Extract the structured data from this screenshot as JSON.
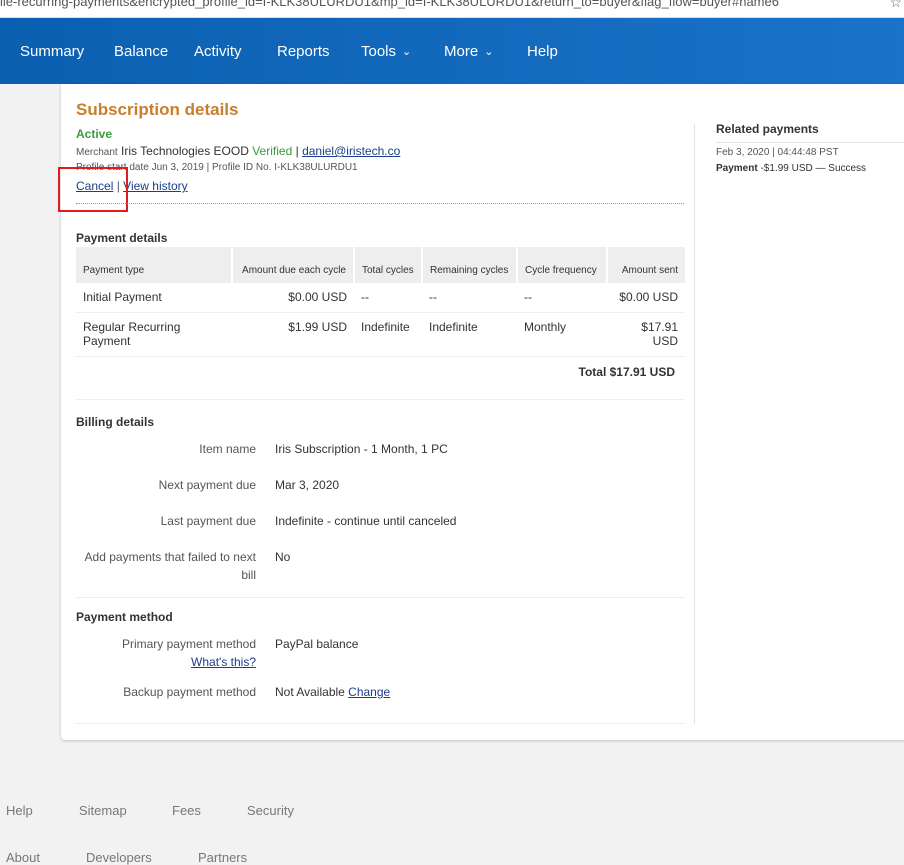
{
  "browser": {
    "url_fragment": "ile-recurring-payments&encrypted_profile_id=I-KLK38ULURDU1&mp_id=I-KLK38ULURDU1&return_to=buyer&flag_flow=buyer#name6"
  },
  "nav": {
    "items": [
      "Summary",
      "Balance",
      "Activity",
      "Reports",
      "Tools",
      "More",
      "Help"
    ]
  },
  "subscription": {
    "title": "Subscription details",
    "status": "Active",
    "merchant_label": "Merchant",
    "merchant_name": "Iris Technologies EOOD",
    "verified": "Verified",
    "separator": "|",
    "merchant_email": "daniel@iristech.co",
    "profile_line": "Profile start date Jun 3, 2019 | Profile ID No. I-KLK38ULURDU1",
    "cancel_label": "Cancel",
    "view_history_label": "View history"
  },
  "payment_details": {
    "title": "Payment details",
    "headers": [
      "Payment type",
      "Amount due each cycle",
      "Total cycles",
      "Remaining cycles",
      "Cycle frequency",
      "Amount sent"
    ],
    "rows": [
      [
        "Initial Payment",
        "$0.00 USD",
        "--",
        "--",
        "--",
        "$0.00 USD"
      ],
      [
        "Regular Recurring Payment",
        "$1.99 USD",
        "Indefinite",
        "Indefinite",
        "Monthly",
        "$17.91 USD"
      ]
    ],
    "total": "Total $17.91 USD"
  },
  "billing_details": {
    "title": "Billing details",
    "item_name_label": "Item name",
    "item_name_value": "Iris Subscription - 1 Month, 1 PC",
    "next_payment_label": "Next payment due",
    "next_payment_value": "Mar 3, 2020",
    "last_payment_label": "Last payment due",
    "last_payment_value": "Indefinite - continue until canceled",
    "add_failed_label": "Add payments that failed to next bill",
    "add_failed_value": "No"
  },
  "payment_method": {
    "title": "Payment method",
    "primary_label": "Primary payment method",
    "whats_this": "What's this?",
    "primary_value": "PayPal balance",
    "backup_label": "Backup payment method",
    "backup_value": "Not Available",
    "change_label": "Change"
  },
  "related": {
    "title": "Related payments",
    "date": "Feb 3, 2020 | 04:44:48 PST",
    "payment_label": "Payment",
    "payment_detail": " -$1.99 USD — Success"
  },
  "footer": {
    "row1": [
      "Help",
      "Sitemap",
      "Fees",
      "Security"
    ],
    "row2": [
      "About",
      "Developers",
      "Partners"
    ]
  },
  "colors": {
    "nav_bg": "#0b5fb0",
    "title_orange": "#c97e2c",
    "active_green": "#3a9b3a",
    "highlight_red": "#e01b1b"
  }
}
